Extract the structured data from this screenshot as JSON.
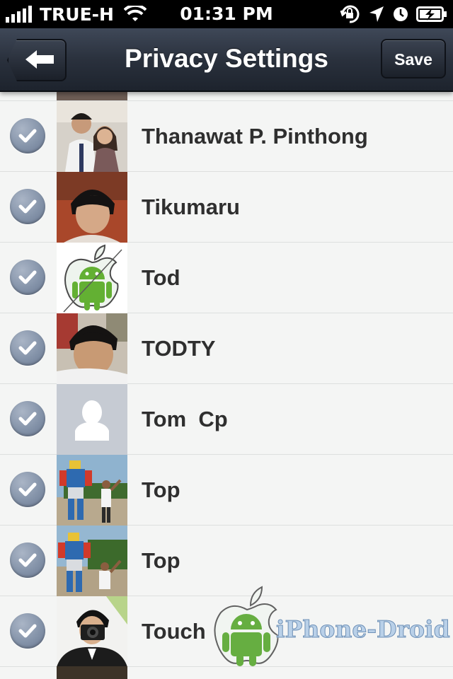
{
  "status_bar": {
    "carrier": "TRUE-H",
    "time": "01:31 PM"
  },
  "nav": {
    "title": "Privacy Settings",
    "save_label": "Save"
  },
  "contacts": [
    {
      "name": "Thanawat P. Pinthong",
      "checked": true,
      "avatar": "photo-couple"
    },
    {
      "name": "Tikumaru",
      "checked": true,
      "avatar": "photo-girl"
    },
    {
      "name": "Tod",
      "checked": true,
      "avatar": "android-apple-logo"
    },
    {
      "name": "TODTY",
      "checked": true,
      "avatar": "photo-selfie"
    },
    {
      "name": "Tom  Cp",
      "checked": true,
      "avatar": "default-silhouette"
    },
    {
      "name": "Top",
      "checked": true,
      "avatar": "photo-robot-statue"
    },
    {
      "name": "Top",
      "checked": true,
      "avatar": "photo-robot-statue"
    },
    {
      "name": "Touch",
      "checked": true,
      "avatar": "photo-camera-man"
    }
  ],
  "watermark": {
    "text": "iPhone-Droid"
  },
  "colors": {
    "nav_bar": "#2a313d",
    "check_badge": "#8493a9",
    "row_background": "#f4f5f4",
    "name_text": "#2f2f2f"
  }
}
